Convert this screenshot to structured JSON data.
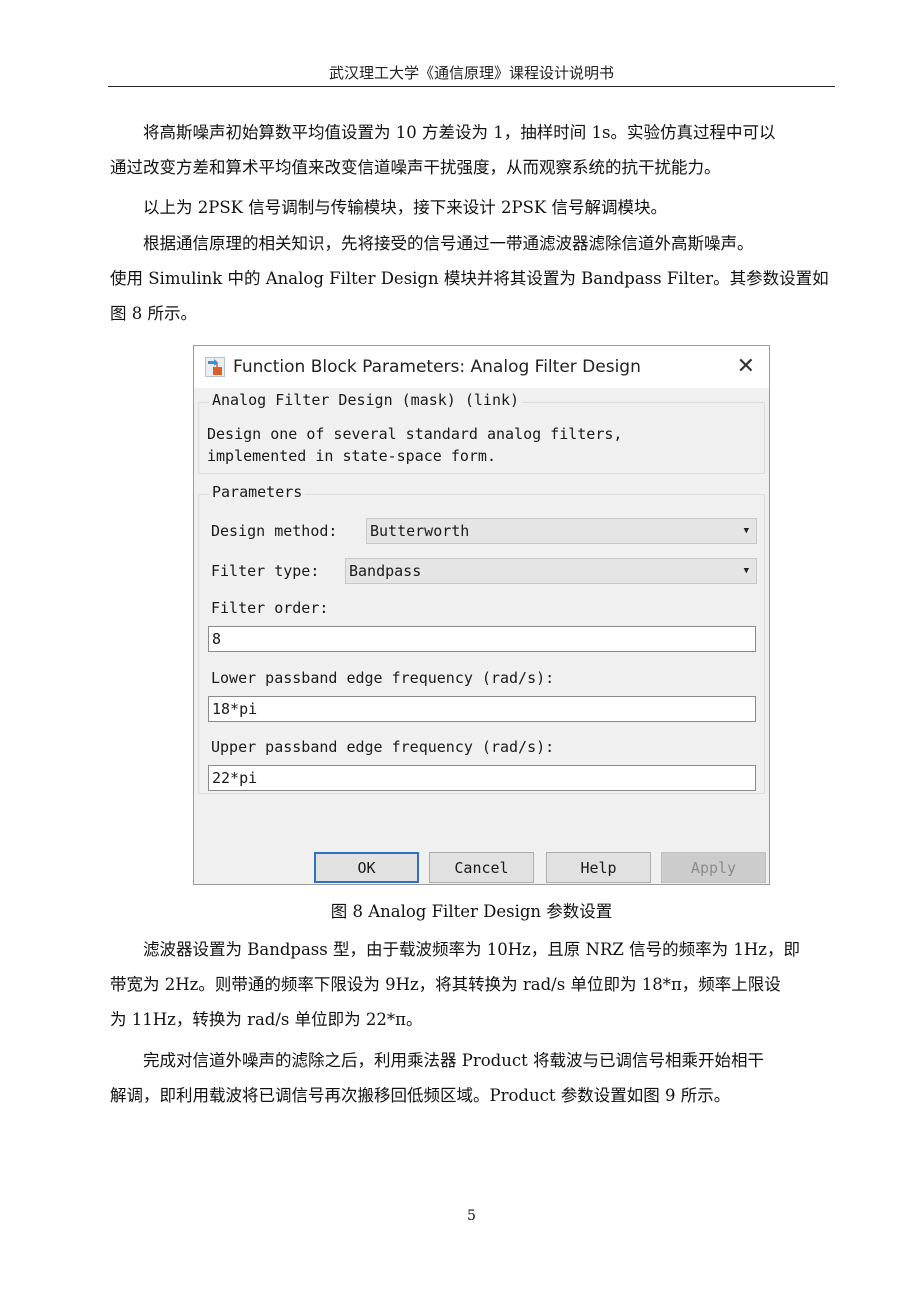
{
  "header": {
    "title": "武汉理工大学《通信原理》课程设计说明书"
  },
  "paragraphs": {
    "p1": [
      "将高斯噪声初始算数平均值设置为 10 方差设为 1，抽样时间 1s。实验仿真过程中可以",
      "通过改变方差和算术平均值来改变信道噪声干扰强度，从而观察系统的抗干扰能力。"
    ],
    "p2": [
      "以上为 2PSK 信号调制与传输模块，接下来设计 2PSK 信号解调模块。"
    ],
    "p3": [
      "根据通信原理的相关知识，先将接受的信号通过一带通滤波器滤除信道外高斯噪声。",
      "使用 Simulink 中的 Analog Filter Design 模块并将其设置为 Bandpass Filter。其参数设置如",
      "图 8 所示。"
    ],
    "p4": [
      "滤波器设置为 Bandpass 型，由于载波频率为 10Hz，且原 NRZ 信号的频率为 1Hz，即",
      "带宽为 2Hz。则带通的频率下限设为 9Hz，将其转换为 rad/s 单位即为 18*π，频率上限设",
      "为 11Hz，转换为 rad/s 单位即为 22*π。"
    ],
    "p5": [
      "完成对信道外噪声的滤除之后，利用乘法器 Product 将载波与已调信号相乘开始相干",
      "解调，即利用载波将已调信号再次搬移回低频区域。Product 参数设置如图 9 所示。"
    ]
  },
  "dialog": {
    "title": "Function Block Parameters: Analog Filter Design",
    "icon": "simulink-block-icon",
    "close_icon": "close-icon",
    "mask_group_title": "Analog Filter Design (mask) (link)",
    "description": [
      "Design one of several standard analog filters,",
      "implemented in state-space form."
    ],
    "params_group_title": "Parameters",
    "design_method": {
      "label": "Design method:",
      "value": "Butterworth"
    },
    "filter_type": {
      "label": "Filter type:",
      "value": "Bandpass"
    },
    "filter_order": {
      "label": "Filter order:",
      "value": "8"
    },
    "lower_freq": {
      "label": "Lower passband edge frequency (rad/s):",
      "value": "18*pi"
    },
    "upper_freq": {
      "label": "Upper passband edge frequency (rad/s):",
      "value": "22*pi"
    },
    "buttons": {
      "ok": "OK",
      "cancel": "Cancel",
      "help": "Help",
      "apply": "Apply"
    }
  },
  "caption": "图 8 Analog Filter Design 参数设置",
  "page_number": "5"
}
